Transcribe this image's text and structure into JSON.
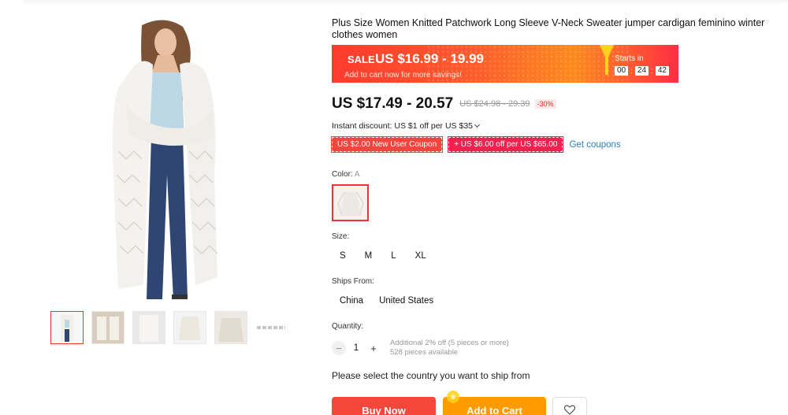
{
  "product": {
    "title": "Plus Size Women Knitted Patchwork Long Sleeve V-Neck Sweater jumper cardigan feminino winter clothes women"
  },
  "sale": {
    "label": "SALE",
    "price": "US $16.99 - 19.99",
    "sub": "Add to cart now for more savings!",
    "starts_in": "Starts in",
    "countdown": [
      "00",
      "24",
      "42"
    ],
    "separator": ":"
  },
  "pricing": {
    "price": "US $17.49 - 20.57",
    "original": "US $24.98 - 29.39",
    "discount": "-30%"
  },
  "instant_discount": "Instant discount: US $1 off per US $35",
  "coupons": {
    "new_user": "US $2.00 New User Coupon",
    "store": "+ US $6.00 off per US $65.00",
    "get": "Get coupons"
  },
  "color": {
    "label": "Color:",
    "selected": "A"
  },
  "size": {
    "label": "Size:",
    "options": [
      "S",
      "M",
      "L",
      "XL"
    ]
  },
  "ships_from": {
    "label": "Ships From:",
    "options": [
      "China",
      "United States"
    ]
  },
  "quantity": {
    "label": "Quantity:",
    "minus": "−",
    "value": "1",
    "plus": "+",
    "note1": "Additional 2% off (5 pieces or more)",
    "note2": "528 pieces available"
  },
  "ship_country_msg": "Please select the country you want to ship from",
  "buttons": {
    "buy_now": "Buy Now",
    "add_to_cart": "Add to Cart"
  },
  "colors": {
    "accent": "#f5473c",
    "cart": "#ff9a00",
    "link": "#2b7fbd"
  }
}
